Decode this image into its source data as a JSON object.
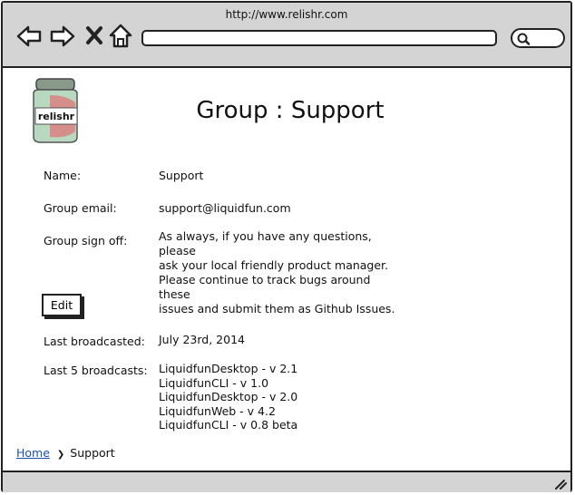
{
  "browser": {
    "url": "http://www.relishr.com"
  },
  "logo": {
    "text": "relishr"
  },
  "page": {
    "title": "Group : Support"
  },
  "fields": {
    "name_label": "Name:",
    "name_value": "Support",
    "email_label": "Group email:",
    "email_value": "support@liquidfun.com",
    "signoff_label": "Group sign off:",
    "signoff_lines": [
      "As always, if you have any questions, please",
      "ask your local friendly product manager.",
      "Please continue to track bugs around these",
      "issues and submit them as Github Issues."
    ],
    "edit_label": "Edit",
    "last_broadcasted_label": "Last broadcasted:",
    "last_broadcasted_value": "July 23rd, 2014",
    "last5_label": "Last 5 broadcasts:",
    "last5": [
      "LiquidfunDesktop - v 2.1",
      "LiquidfunCLI - v 1.0",
      "LiquidfunDesktop - v 2.0",
      "LiquidfunWeb - v 4.2",
      "LiquidfunCLI - v 0.8 beta"
    ]
  },
  "breadcrumb": {
    "home": "Home",
    "separator": "❯",
    "current": "Support"
  },
  "icons": [
    "back-icon",
    "forward-icon",
    "close-icon",
    "home-icon",
    "search-icon",
    "resize-grip-icon"
  ]
}
